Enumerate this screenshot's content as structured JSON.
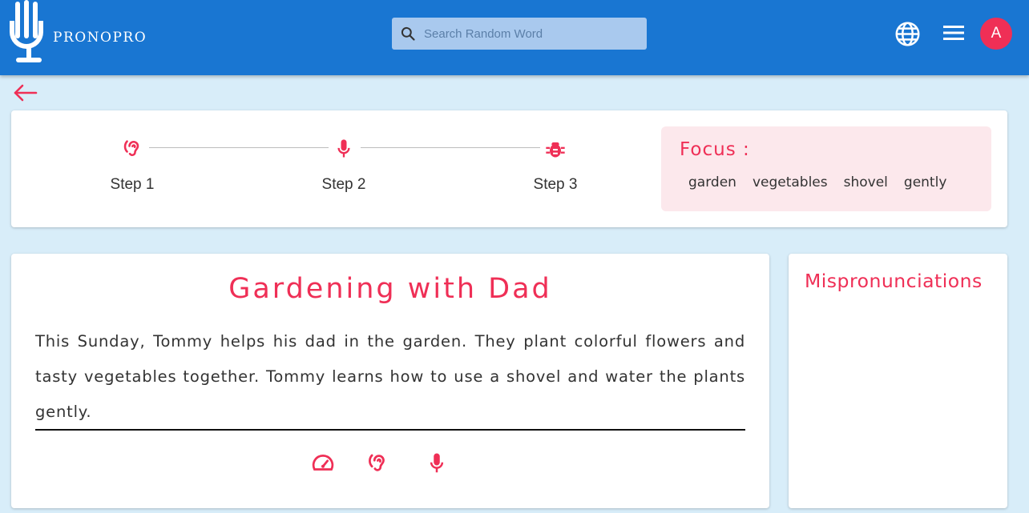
{
  "app": {
    "brand": "PRONOPRO",
    "search_placeholder": "Search Random Word",
    "avatar_initial": "A"
  },
  "steps": [
    {
      "label": "Step 1",
      "icon": "ear-icon"
    },
    {
      "label": "Step 2",
      "icon": "microphone-icon"
    },
    {
      "label": "Step 3",
      "icon": "bug-icon"
    }
  ],
  "focus": {
    "title": "Focus :",
    "words": [
      "garden",
      "vegetables",
      "shovel",
      "gently"
    ]
  },
  "story": {
    "title": "Gardening with Dad",
    "text": "This Sunday, Tommy helps his dad in the garden. They plant colorful flowers and tasty vegetables together. Tommy learns how to use a shovel and water the plants gently."
  },
  "tools": [
    "speedometer-icon",
    "ear-icon",
    "microphone-icon"
  ],
  "mispronunciations": {
    "title": "Mispronunciations"
  },
  "colors": {
    "topbar": "#1976d2",
    "accent": "#ef2f56",
    "page_bg": "#d8edf9",
    "focus_bg": "#fce8ec"
  }
}
